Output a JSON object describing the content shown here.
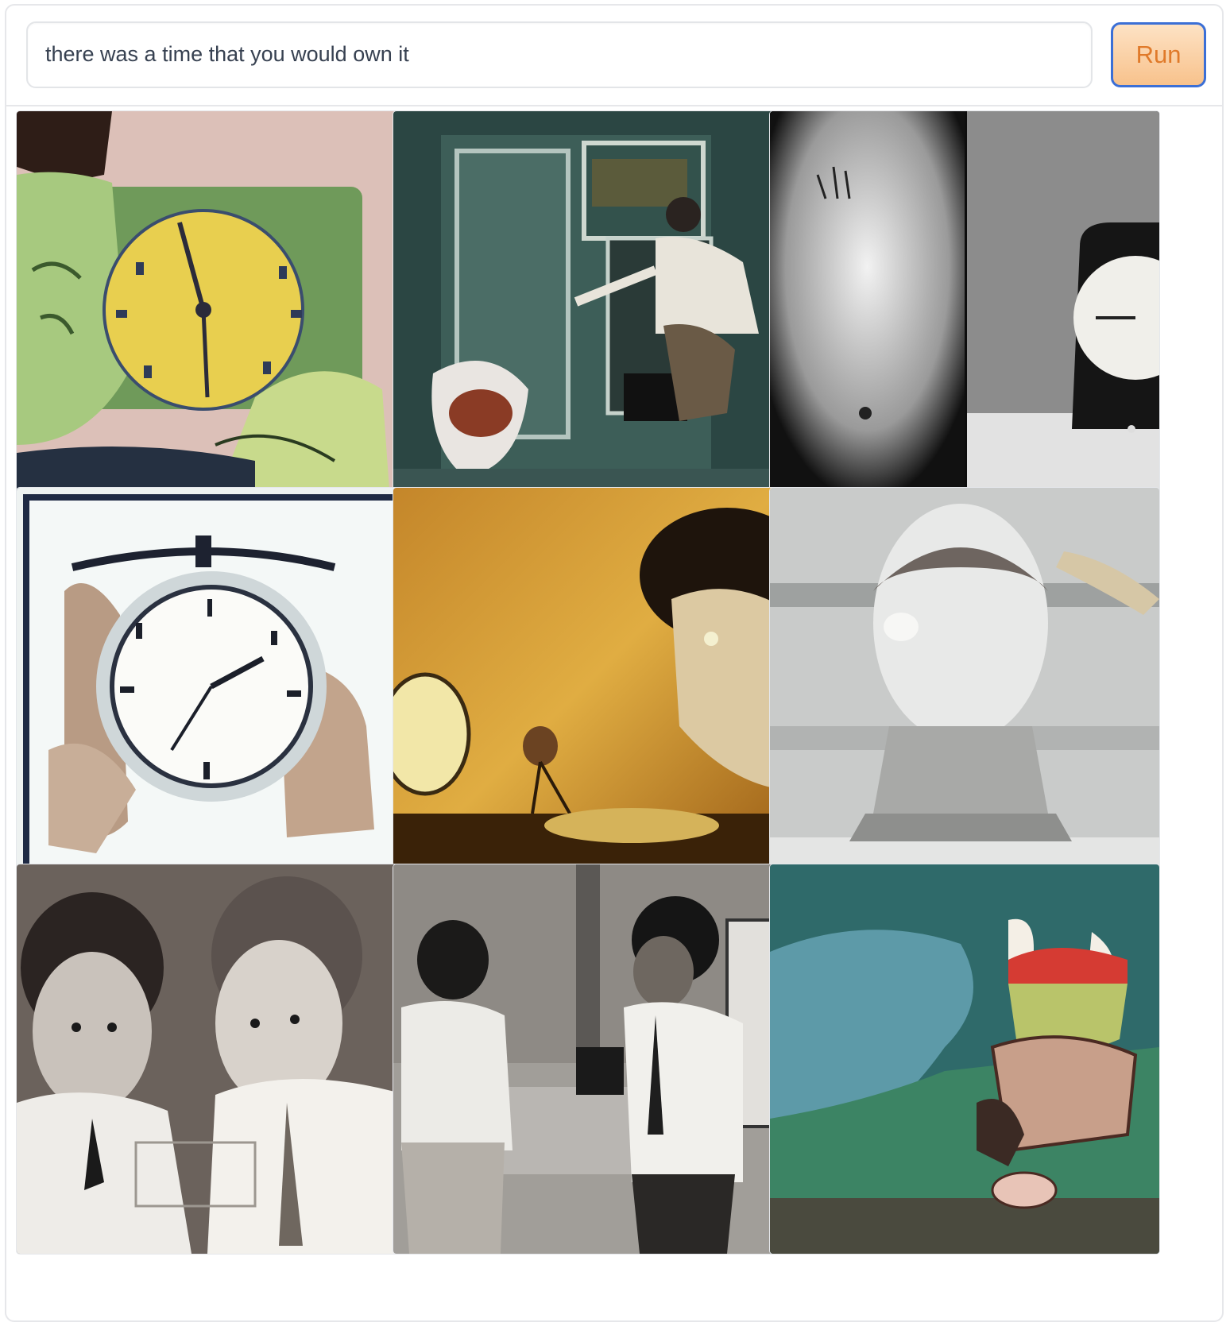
{
  "prompt": {
    "value": "there was a time that you would own it"
  },
  "run_button": {
    "label": "Run"
  },
  "gallery": {
    "images": [
      {
        "name": "generated-image-1",
        "subject": "green-face-yellow-clock"
      },
      {
        "name": "generated-image-2",
        "subject": "teal-room-figures"
      },
      {
        "name": "generated-image-3",
        "subject": "monochrome-clock-diptych"
      },
      {
        "name": "generated-image-4",
        "subject": "polaroid-alarm-clock"
      },
      {
        "name": "generated-image-5",
        "subject": "yellow-wall-clock-and-face"
      },
      {
        "name": "generated-image-6",
        "subject": "glass-head-sculpture"
      },
      {
        "name": "generated-image-7",
        "subject": "two-boys-in-ties"
      },
      {
        "name": "generated-image-8",
        "subject": "bw-room-two-people"
      },
      {
        "name": "generated-image-9",
        "subject": "teal-cartoon-figure"
      }
    ]
  }
}
